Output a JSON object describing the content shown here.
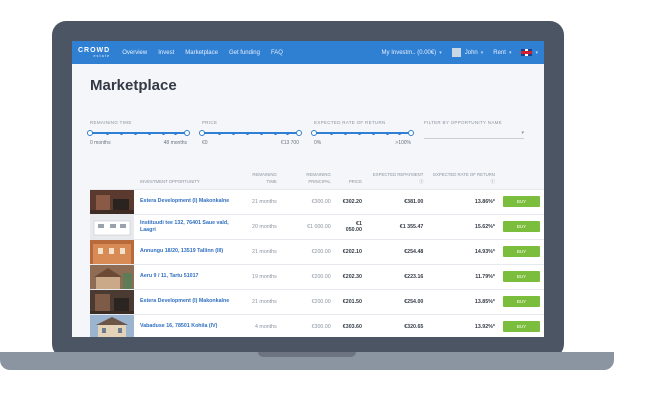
{
  "nav": {
    "logo_main": "CROWD",
    "logo_sub": "estate",
    "items": [
      "Overview",
      "Invest",
      "Marketplace",
      "Get funding",
      "FAQ"
    ],
    "investor": "My Investm.. (0.00€)",
    "user": "John",
    "role": "Rent"
  },
  "page_title": "Marketplace",
  "filters": {
    "remaining_time": {
      "label": "REMAINING TIME",
      "min": "0 months",
      "max": "48 months"
    },
    "price": {
      "label": "PRICE",
      "min": "€0",
      "max": "€13 700"
    },
    "return": {
      "label": "EXPECTED RATE OF RETURN",
      "min": "0%",
      "max": ">100%"
    },
    "opportunity": {
      "label": "FILTER BY OPPORTUNITY NAME",
      "value": ""
    }
  },
  "table": {
    "headers": [
      "INVESTMENT OPPORTUNITY",
      "REMAINING TIME",
      "REMAINING PRINCIPAL",
      "PRICE",
      "EXPECTED REPAYMENT ⓘ",
      "EXPECTED RATE OF RETURN ⓘ"
    ],
    "buy_label": "BUY",
    "rows": [
      {
        "name": "Estera Development (I) Makonkalne",
        "time": "21 months",
        "principal": "€300.00",
        "price": "€302.20",
        "repayment": "€381.00",
        "return": "13.86%*"
      },
      {
        "name": "Instituudi tee 132, 76401 Saue vald, Laagri",
        "time": "20 months",
        "principal": "€1 000.00",
        "price": "€1 050.00",
        "repayment": "€1 355.47",
        "return": "15.62%*"
      },
      {
        "name": "Annungu 18/20, 13519 Tallinn (III)",
        "time": "21 months",
        "principal": "€200.00",
        "price": "€202.10",
        "repayment": "€254.48",
        "return": "14.93%*"
      },
      {
        "name": "Aeru 9 / 11, Tartu 51017",
        "time": "19 months",
        "principal": "€200.00",
        "price": "€202.30",
        "repayment": "€223.16",
        "return": "11.79%*"
      },
      {
        "name": "Estera Development (I) Makonkalne",
        "time": "21 months",
        "principal": "€200.00",
        "price": "€201.50",
        "repayment": "€254.00",
        "return": "13.85%*"
      },
      {
        "name": "Vabaduse 16, 78501 Kohila (IV)",
        "time": "4 months",
        "principal": "€300.00",
        "price": "€303.60",
        "repayment": "€320.65",
        "return": "13.92%*"
      }
    ]
  }
}
